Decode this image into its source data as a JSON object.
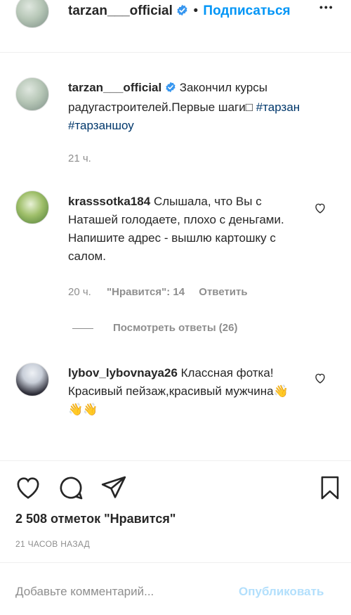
{
  "header": {
    "username": "tarzan___official",
    "separator": "•",
    "follow_label": "Подписаться",
    "more_label": "•••"
  },
  "caption": {
    "username": "tarzan___official",
    "text": "Закончил курсы радугастроителей.Первые шаги",
    "glyph": "□",
    "hashtags": [
      "#тарзан",
      "#тарзаншоу"
    ],
    "time": "21 ч."
  },
  "comments": [
    {
      "username": "krasssotka184",
      "text": "Слышала, что Вы с Наташей голодаете, плохо с деньгами. Напишите адрес - вышлю картошку с салом.",
      "time": "20 ч.",
      "likes": "\"Нравится\": 14",
      "reply_label": "Ответить",
      "view_replies": "Посмотреть ответы (26)"
    },
    {
      "username": "lybov_lybovnaya26",
      "text": "Классная фотка!Красивый пейзаж,красивый мужчина",
      "emoji": "👋👋👋"
    }
  ],
  "actions": {
    "likes_count": "2 508 отметок \"Нравится\"",
    "posted_ago": "21 ЧАСОВ НАЗАД"
  },
  "comment_box": {
    "placeholder": "Добавьте комментарий...",
    "publish_label": "Опубликовать"
  },
  "colors": {
    "link": "#0095f6",
    "hashtag": "#00376b",
    "muted": "#8e8e8e",
    "verified": "#3897f0"
  }
}
